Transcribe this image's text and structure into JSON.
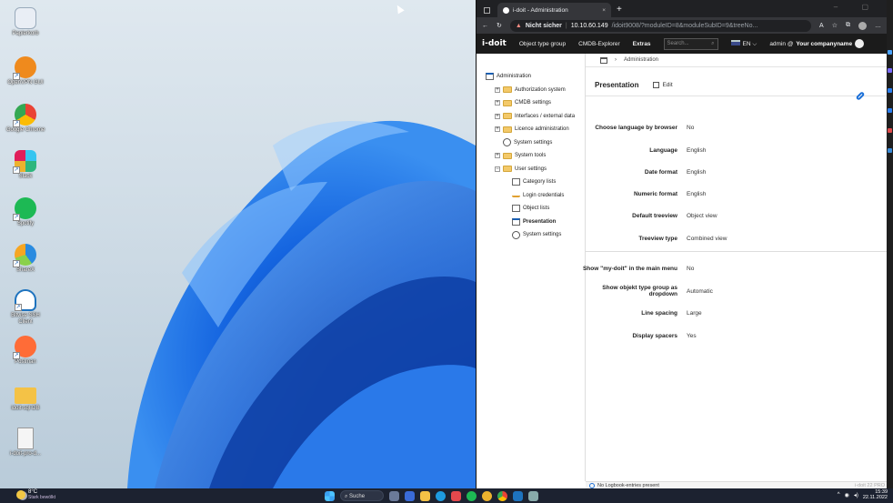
{
  "desktop": {
    "icons": [
      {
        "label": "Papierkorb",
        "name": "recycle-bin-icon",
        "color": "#e9eef5"
      },
      {
        "label": "OpenVPN GUI",
        "name": "openvpn-icon",
        "color": "#ef8a1d"
      },
      {
        "label": "Google Chrome",
        "name": "chrome-icon",
        "color": "#34a853"
      },
      {
        "label": "Slack",
        "name": "slack-icon",
        "color": "#ecb22e"
      },
      {
        "label": "Spotify",
        "name": "spotify-icon",
        "color": "#1db954"
      },
      {
        "label": "ShareX",
        "name": "sharex-icon",
        "color": "#2a8be0"
      },
      {
        "label": "Bitvise SSH Client",
        "name": "bitvise-icon",
        "color": "#1e73be"
      },
      {
        "label": "Postman",
        "name": "postman-icon",
        "color": "#ff6c37"
      },
      {
        "label": "idoit-sql-DB",
        "name": "folder-icon",
        "color": "#f4c246"
      },
      {
        "label": "i-doit-pro-d...",
        "name": "file-icon",
        "color": "#f5f5f5"
      }
    ]
  },
  "taskbar": {
    "weather_temp": "8°C",
    "weather_desc": "Stark bewölkt",
    "search_label": "Suche",
    "time": "15:39",
    "date": "22.11.2022"
  },
  "browser": {
    "tab_title": "i-doit - Administration",
    "not_secure": "Nicht sicher",
    "url_host": "10.10.60.149",
    "url_rest": "/idoit9008/?moduleID=8&moduleSubID=9&treeNo...",
    "idoit": {
      "logo": "i-doit",
      "nav": {
        "object_type_group": "Object type group",
        "cmdb_explorer": "CMDB-Explorer",
        "extras": "Extras",
        "search_placeholder": "Search...",
        "language": "EN",
        "user": "admin @",
        "company": "Your companyname"
      },
      "tree": [
        {
          "label": "Administration",
          "indent": 0,
          "type": "window"
        },
        {
          "label": "Authorization system",
          "indent": 1,
          "type": "folder"
        },
        {
          "label": "CMDB settings",
          "indent": 1,
          "type": "folder"
        },
        {
          "label": "Interfaces / external data",
          "indent": 1,
          "type": "folder"
        },
        {
          "label": "Licence administration",
          "indent": 1,
          "type": "folder"
        },
        {
          "label": "System settings",
          "indent": 1,
          "type": "gear"
        },
        {
          "label": "System tools",
          "indent": 1,
          "type": "folder"
        },
        {
          "label": "User settings",
          "indent": 1,
          "type": "folder"
        },
        {
          "label": "Category lists",
          "indent": 2,
          "type": "grid"
        },
        {
          "label": "Login credentials",
          "indent": 2,
          "type": "key"
        },
        {
          "label": "Object lists",
          "indent": 2,
          "type": "grid"
        },
        {
          "label": "Presentation",
          "indent": 2,
          "type": "window",
          "active": true
        },
        {
          "label": "System settings",
          "indent": 2,
          "type": "gear"
        }
      ],
      "breadcrumb": "Administration",
      "page_title": "Presentation",
      "edit_label": "Edit",
      "fields": [
        {
          "label": "Choose language by browser",
          "value": "No"
        },
        {
          "label": "Language",
          "value": "English"
        },
        {
          "label": "Date format",
          "value": "English"
        },
        {
          "label": "Numeric format",
          "value": "English"
        },
        {
          "label": "Default treeview",
          "value": "Object view"
        },
        {
          "label": "Treeview type",
          "value": "Combined view"
        },
        {
          "label": "Show \"my-doit\" in the main menu",
          "value": "No"
        },
        {
          "label": "Show objekt type group as dropdown",
          "value": "Automatic"
        },
        {
          "label": "Line spacing",
          "value": "Large"
        },
        {
          "label": "Display spacers",
          "value": "Yes"
        }
      ],
      "status": "No Logbook-entries present",
      "version": "i-doit 22 PRO"
    }
  }
}
